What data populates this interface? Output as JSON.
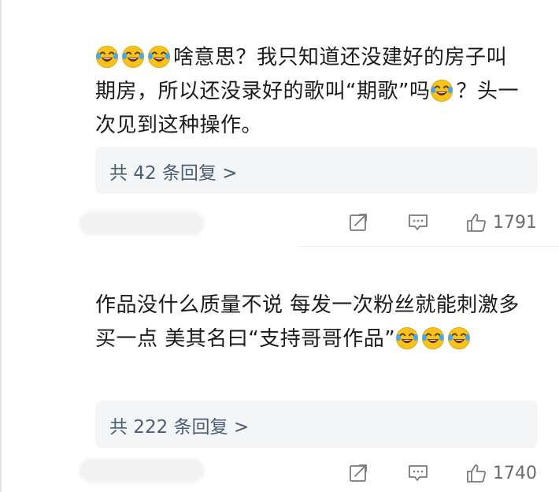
{
  "comments": [
    {
      "lead_emojis": [
        "laugh-cry",
        "laugh-cry",
        "laugh-cry"
      ],
      "text_part1": "啥意思？我只知道还没建好的房子叫期房，所以还没录好的歌叫“期歌”吗",
      "mid_emoji": "laugh-cry",
      "text_part2": "？头一次见到这种操作。",
      "replies_label": "共 42 条回复 >",
      "like_count": "1791"
    },
    {
      "text_part1": "作品没什么质量不说 每发一次粉丝就能刺激多买一点  美其名曰“支持哥哥作品”",
      "trailing_emojis": [
        "laugh-cry",
        "laugh-cry",
        "laugh-cry"
      ],
      "replies_label": "共 222 条回复 >",
      "like_count": "1740"
    }
  ],
  "icons": {
    "share": "share-icon",
    "comment": "comment-icon",
    "like": "thumbs-up-icon",
    "emoji": "laugh-cry-emoji"
  },
  "colors": {
    "reply_link": "#4a5e76",
    "reply_bg": "#f4f5f6",
    "icon_stroke": "#7a7a7a"
  }
}
